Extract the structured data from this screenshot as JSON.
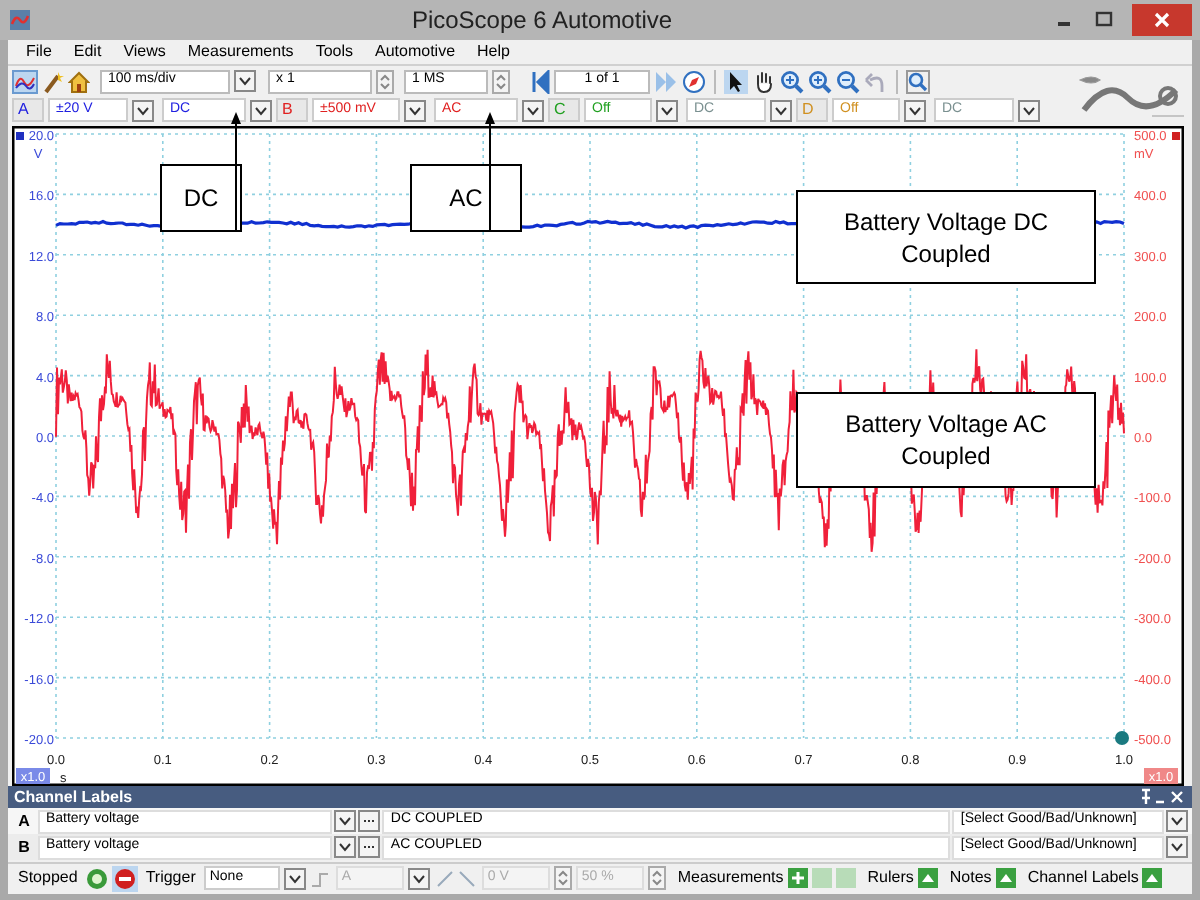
{
  "window": {
    "title": "PicoScope 6 Automotive"
  },
  "menu": [
    "File",
    "Edit",
    "Views",
    "Measurements",
    "Tools",
    "Automotive",
    "Help"
  ],
  "toolbar": {
    "timebase": "100 ms/div",
    "zoom": "x 1",
    "samples": "1 MS",
    "buffer": "1 of 1"
  },
  "channels": [
    {
      "letter": "A",
      "range": "±20 V",
      "coupling": "DC",
      "enabled": true,
      "color": "#2020e0"
    },
    {
      "letter": "B",
      "range": "±500 mV",
      "coupling": "AC",
      "enabled": true,
      "color": "#e02020"
    },
    {
      "letter": "C",
      "range": "Off",
      "coupling": "DC",
      "enabled": false,
      "color": "#20a020"
    },
    {
      "letter": "D",
      "range": "Off",
      "coupling": "DC",
      "enabled": false,
      "color": "#d09020"
    }
  ],
  "plot": {
    "left_axis": {
      "unit": "V",
      "ticks": [
        "20.0",
        "16.0",
        "12.0",
        "8.0",
        "4.0",
        "0.0",
        "-4.0",
        "-8.0",
        "-12.0",
        "-16.0",
        "-20.0"
      ],
      "scale": "x1.0"
    },
    "right_axis": {
      "unit": "mV",
      "ticks": [
        "500.0",
        "400.0",
        "300.0",
        "200.0",
        "100.0",
        "0.0",
        "-100.0",
        "-200.0",
        "-300.0",
        "-400.0",
        "-500.0"
      ],
      "scale": "x1.0"
    },
    "x_axis": {
      "unit": "s",
      "ticks": [
        "0.0",
        "0.1",
        "0.2",
        "0.3",
        "0.4",
        "0.5",
        "0.6",
        "0.7",
        "0.8",
        "0.9",
        "1.0"
      ]
    },
    "callouts": [
      {
        "text": "DC"
      },
      {
        "text": "AC"
      },
      {
        "text": "Battery Voltage DC Coupled"
      },
      {
        "text": "Battery Voltage AC Coupled"
      }
    ]
  },
  "channel_labels": {
    "title": "Channel Labels",
    "rows": [
      {
        "channel": "A",
        "label": "Battery voltage",
        "note": "DC COUPLED",
        "status": "[Select Good/Bad/Unknown]"
      },
      {
        "channel": "B",
        "label": "Battery voltage",
        "note": "AC COUPLED",
        "status": "[Select Good/Bad/Unknown]"
      }
    ]
  },
  "status_bar": {
    "state": "Stopped",
    "trigger_label": "Trigger",
    "trigger_mode": "None",
    "trigger_source": "A",
    "threshold": "0 V",
    "pre_trigger": "50 %",
    "measurements": "Measurements",
    "rulers": "Rulers",
    "notes": "Notes",
    "channel_labels": "Channel Labels"
  }
}
